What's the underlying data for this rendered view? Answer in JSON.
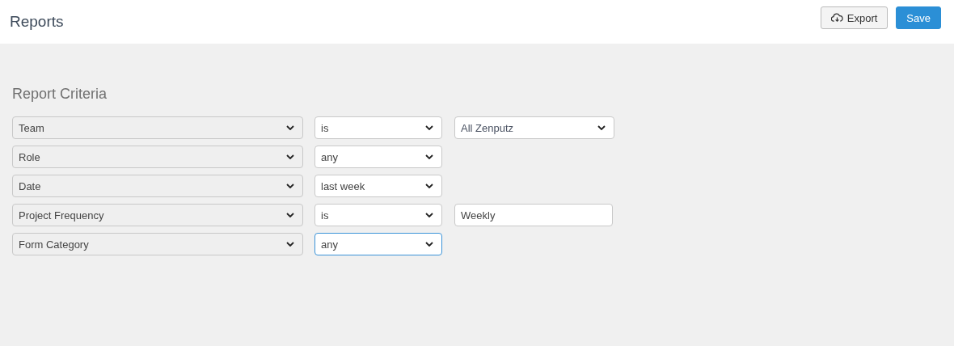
{
  "header": {
    "title": "Reports",
    "buttons": [
      {
        "label": "Export",
        "kind": "export"
      },
      {
        "label": "Save",
        "kind": "primary"
      }
    ]
  },
  "section": {
    "title": "Report Criteria"
  },
  "criteria": [
    {
      "field": "Team",
      "operator": {
        "text": "is",
        "focused": false
      },
      "value": {
        "kind": "select",
        "text": "All Zenputz"
      }
    },
    {
      "field": "Role",
      "operator": {
        "text": "any",
        "focused": false
      }
    },
    {
      "field": "Date",
      "operator": {
        "text": "last week",
        "focused": false
      }
    },
    {
      "field": "Project Frequency",
      "operator": {
        "text": "is",
        "focused": false
      },
      "value": {
        "kind": "text",
        "text": "Weekly"
      }
    },
    {
      "field": "Form Category",
      "operator": {
        "text": "any",
        "focused": true
      }
    }
  ]
}
